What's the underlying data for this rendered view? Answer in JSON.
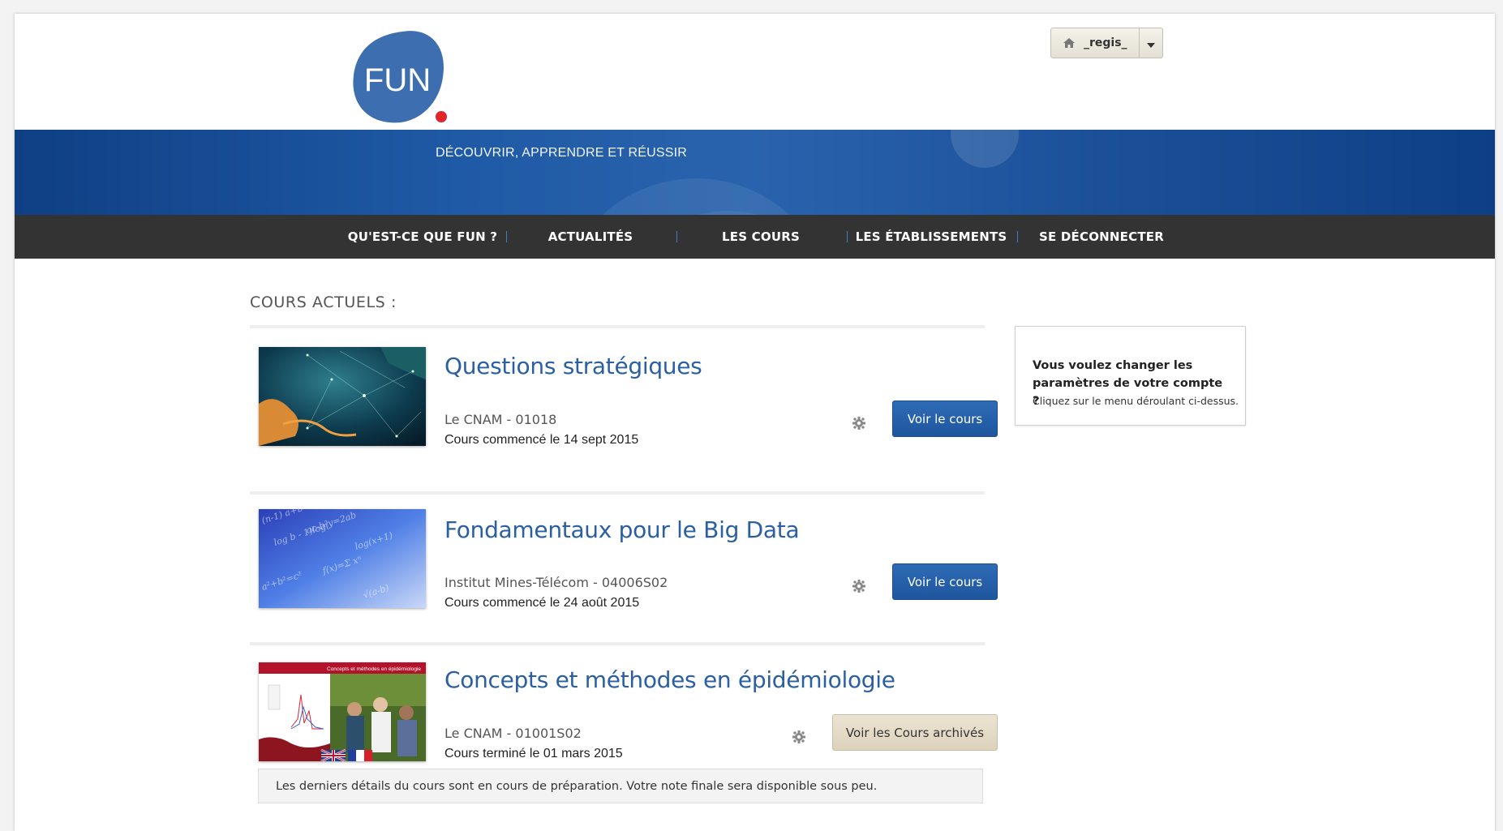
{
  "header": {
    "logo_text": "FUN",
    "user_name": "_regis_"
  },
  "banner": {
    "tagline": "DÉCOUVRIR, APPRENDRE ET RÉUSSIR"
  },
  "nav": {
    "items": [
      {
        "label": "QU'EST-CE QUE FUN ?"
      },
      {
        "label": "ACTUALITÉS"
      },
      {
        "label": "LES COURS"
      },
      {
        "label": "LES ÉTABLISSEMENTS"
      },
      {
        "label": "SE DÉCONNECTER"
      }
    ]
  },
  "main": {
    "section_title": "COURS ACTUELS :",
    "courses": [
      {
        "title": "Questions stratégiques",
        "org": "Le CNAM - 01018",
        "date": "Cours commencé le 14 sept 2015",
        "button": "Voir le cours"
      },
      {
        "title": "Fondamentaux pour le Big Data",
        "org": "Institut Mines-Télécom - 04006S02",
        "date": "Cours commencé le 24 août 2015",
        "button": "Voir le cours"
      },
      {
        "title": "Concepts et méthodes en épidémiologie",
        "org": "Le CNAM - 01001S02",
        "date": "Cours terminé le 01 mars 2015",
        "button": "Voir les Cours archivés",
        "thumb_caption": "Concepts et méthodes en épidémiologie"
      }
    ],
    "notice": "Les derniers détails du cours sont en cours de préparation. Votre note finale sera disponible sous peu."
  },
  "sidebar": {
    "question": "Vous voulez changer les paramètres de votre compte ?",
    "hint": "Cliquez sur le menu déroulant ci-dessus."
  },
  "colors": {
    "brand_blue": "#2a5fa4",
    "nav_bg": "#333333",
    "logo_dot": "#e4242b"
  }
}
